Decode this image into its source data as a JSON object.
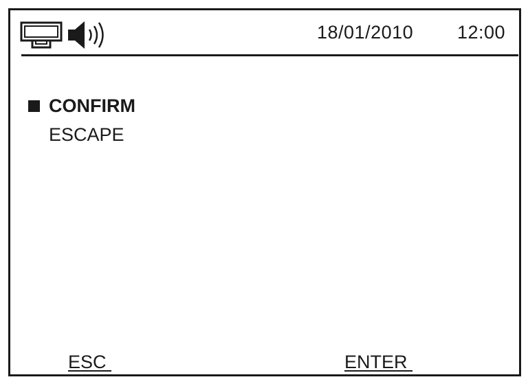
{
  "status_bar": {
    "icons": [
      "network-icon",
      "speaker-icon"
    ],
    "date": "18/01/2010",
    "time": "12:00"
  },
  "menu": {
    "items": [
      {
        "label": "CONFIRM",
        "selected": true
      },
      {
        "label": "ESCAPE",
        "selected": false
      }
    ]
  },
  "softkeys": {
    "left": "ESC ",
    "right": "ENTER "
  },
  "colors": {
    "foreground": "#1a1a1a",
    "background": "#ffffff"
  }
}
